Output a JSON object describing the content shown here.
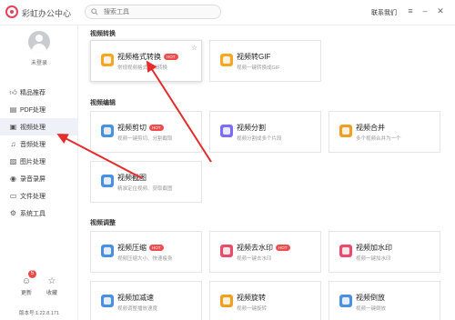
{
  "app": {
    "title": "彩虹办公中心"
  },
  "search": {
    "placeholder": "搜索工具"
  },
  "header": {
    "contact": "联系我们"
  },
  "user": {
    "login_text": "未登录"
  },
  "sidebar": {
    "items": [
      {
        "label": "精品推荐",
        "icon": "thumb-up-icon"
      },
      {
        "label": "PDF处理",
        "icon": "pdf-icon"
      },
      {
        "label": "视频处理",
        "icon": "video-icon"
      },
      {
        "label": "音频处理",
        "icon": "music-icon"
      },
      {
        "label": "图片处理",
        "icon": "image-icon"
      },
      {
        "label": "录音录屏",
        "icon": "record-icon"
      },
      {
        "label": "文件处理",
        "icon": "folder-icon"
      },
      {
        "label": "系统工具",
        "icon": "tools-icon"
      }
    ],
    "active_index": 2
  },
  "bottom": {
    "update_label": "更新",
    "update_badge": "5",
    "favorite_label": "收藏"
  },
  "version": "版本号:1.22.8.171",
  "sections": {
    "convert": {
      "title": "视频转换",
      "cards": [
        {
          "name": "视频格式转换",
          "desc": "常规视频格式互相转换",
          "hot": "HOT",
          "color": "#f5a623"
        },
        {
          "name": "视频转GIF",
          "desc": "视频一键转换成GIF",
          "hot": "",
          "color": "#f5a623"
        }
      ]
    },
    "edit": {
      "title": "视频编辑",
      "cards": [
        {
          "name": "视频剪切",
          "desc": "视频一键剪切、分割截取",
          "hot": "HOT",
          "color": "#4a90e2"
        },
        {
          "name": "视频分割",
          "desc": "视频分割成多个片段",
          "hot": "",
          "color": "#7b6cf6"
        },
        {
          "name": "视频合并",
          "desc": "多个视频合并为一个",
          "hot": "",
          "color": "#f0a020"
        },
        {
          "name": "视频截图",
          "desc": "精准定位视频、获取截图",
          "hot": "",
          "color": "#4a90e2"
        }
      ]
    },
    "adjust": {
      "title": "视频调整",
      "cards": [
        {
          "name": "视频压缩",
          "desc": "视频压缩大小、快速瘦身",
          "hot": "HOT",
          "color": "#4a90e2"
        },
        {
          "name": "视频去水印",
          "desc": "视频一键去水印",
          "hot": "HOT",
          "color": "#e94b6a"
        },
        {
          "name": "视频加水印",
          "desc": "视频一键加水印",
          "hot": "",
          "color": "#e94b6a"
        },
        {
          "name": "视频加减速",
          "desc": "视频调整播放速度",
          "hot": "",
          "color": "#4a90e2"
        },
        {
          "name": "视频旋转",
          "desc": "视频一键旋转",
          "hot": "",
          "color": "#f0a020"
        },
        {
          "name": "视频倒放",
          "desc": "视频一键倒放",
          "hot": "",
          "color": "#4a90e2"
        }
      ]
    }
  },
  "annotation_color": "#e52b2b"
}
